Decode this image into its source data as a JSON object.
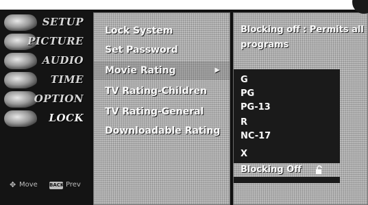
{
  "sidebar": {
    "items": [
      {
        "label": "SETUP",
        "active": false
      },
      {
        "label": "PICTURE",
        "active": false
      },
      {
        "label": "AUDIO",
        "active": false
      },
      {
        "label": "TIME",
        "active": false
      },
      {
        "label": "OPTION",
        "active": false
      },
      {
        "label": "LOCK",
        "active": true
      }
    ],
    "hint": {
      "move_icon": "move-arrows-icon",
      "move_label": "Move",
      "back_key": "BACK",
      "prev_label": "Prev"
    }
  },
  "submenu": {
    "items": [
      {
        "label": "Lock System"
      },
      {
        "label": "Set Password"
      },
      {
        "label": "Movie Rating",
        "selected": true,
        "arrow": "▶"
      },
      {
        "label": "TV Rating-Children"
      },
      {
        "label": "TV Rating-General"
      },
      {
        "label": "Downloadable Rating"
      }
    ]
  },
  "options": {
    "description_line1": "Blocking off : Permits all",
    "description_line2": "programs",
    "ratings": [
      {
        "label": "G"
      },
      {
        "label": "PG"
      },
      {
        "label": "PG-13"
      },
      {
        "label": "R"
      },
      {
        "label": "NC-17"
      },
      {
        "label": "X"
      },
      {
        "label": "Blocking Off",
        "selected": true,
        "icon": "unlock-icon"
      }
    ]
  },
  "colors": {
    "background": "#111111",
    "panel_border": "#6a6a6a",
    "highlight": "#bdbdbd",
    "text": "#fafafa"
  }
}
